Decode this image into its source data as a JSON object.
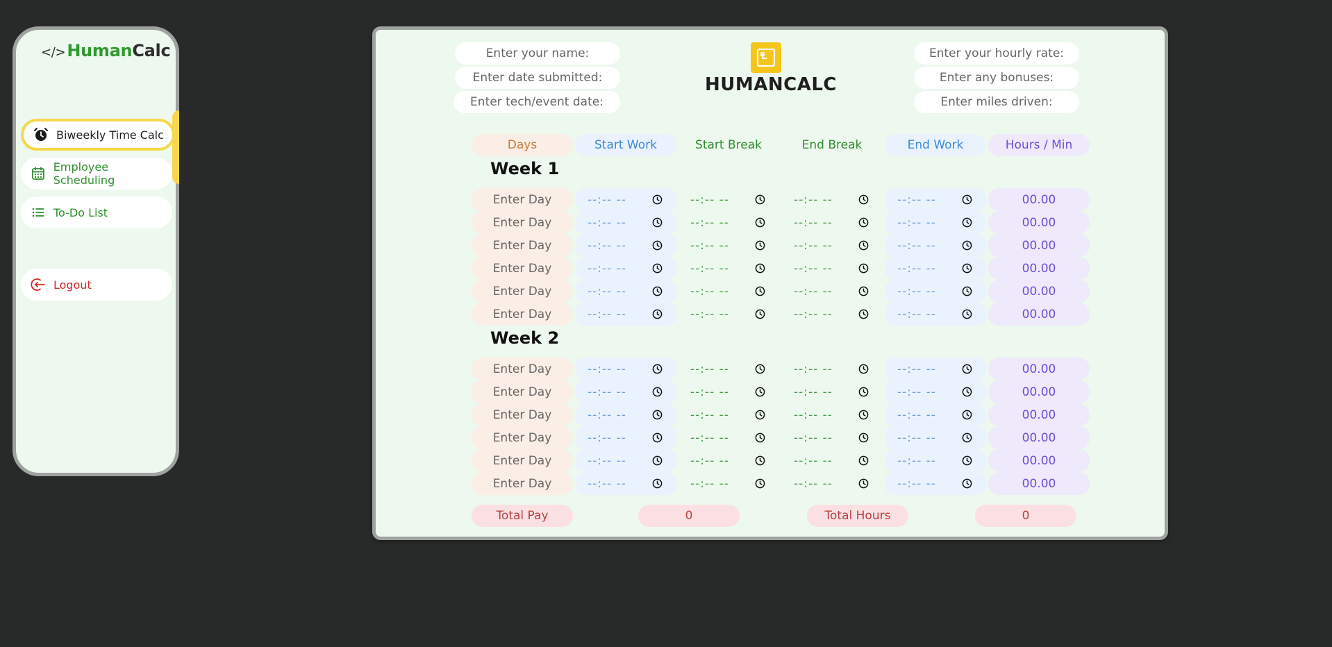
{
  "sidebar": {
    "brand": {
      "code": "</>",
      "human": "Human",
      "calc": "Calc"
    },
    "items": [
      {
        "label": "Biweekly Time Calc",
        "icon": "alarm-clock-icon",
        "active": true
      },
      {
        "label": "Employee Scheduling",
        "icon": "calendar-icon"
      },
      {
        "label": "To-Do List",
        "icon": "list-icon"
      },
      {
        "label": "Logout",
        "icon": "logout-icon"
      }
    ]
  },
  "header": {
    "name_placeholder": "Enter your name:",
    "date_submitted_placeholder": "Enter date submitted:",
    "event_date_placeholder": "Enter tech/event date:",
    "hourly_rate_placeholder": "Enter your hourly rate:",
    "bonuses_placeholder": "Enter any bonuses:",
    "miles_placeholder": "Enter miles driven:",
    "logo_text": "HUMANCALC"
  },
  "columns": {
    "days": "Days",
    "start_work": "Start Work",
    "start_break": "Start Break",
    "end_break": "End Break",
    "end_work": "End Work",
    "hours_min": "Hours / Min"
  },
  "weeks": [
    {
      "title": "Week 1",
      "rows": [
        {
          "day": "Enter Day",
          "start_work": "--:-- --",
          "start_break": "--:-- --",
          "end_break": "--:-- --",
          "end_work": "--:-- --",
          "hours": "00.00"
        },
        {
          "day": "Enter Day",
          "start_work": "--:-- --",
          "start_break": "--:-- --",
          "end_break": "--:-- --",
          "end_work": "--:-- --",
          "hours": "00.00"
        },
        {
          "day": "Enter Day",
          "start_work": "--:-- --",
          "start_break": "--:-- --",
          "end_break": "--:-- --",
          "end_work": "--:-- --",
          "hours": "00.00"
        },
        {
          "day": "Enter Day",
          "start_work": "--:-- --",
          "start_break": "--:-- --",
          "end_break": "--:-- --",
          "end_work": "--:-- --",
          "hours": "00.00"
        },
        {
          "day": "Enter Day",
          "start_work": "--:-- --",
          "start_break": "--:-- --",
          "end_break": "--:-- --",
          "end_work": "--:-- --",
          "hours": "00.00"
        },
        {
          "day": "Enter Day",
          "start_work": "--:-- --",
          "start_break": "--:-- --",
          "end_break": "--:-- --",
          "end_work": "--:-- --",
          "hours": "00.00"
        }
      ]
    },
    {
      "title": "Week 2",
      "rows": [
        {
          "day": "Enter Day",
          "start_work": "--:-- --",
          "start_break": "--:-- --",
          "end_break": "--:-- --",
          "end_work": "--:-- --",
          "hours": "00.00"
        },
        {
          "day": "Enter Day",
          "start_work": "--:-- --",
          "start_break": "--:-- --",
          "end_break": "--:-- --",
          "end_work": "--:-- --",
          "hours": "00.00"
        },
        {
          "day": "Enter Day",
          "start_work": "--:-- --",
          "start_break": "--:-- --",
          "end_break": "--:-- --",
          "end_work": "--:-- --",
          "hours": "00.00"
        },
        {
          "day": "Enter Day",
          "start_work": "--:-- --",
          "start_break": "--:-- --",
          "end_break": "--:-- --",
          "end_work": "--:-- --",
          "hours": "00.00"
        },
        {
          "day": "Enter Day",
          "start_work": "--:-- --",
          "start_break": "--:-- --",
          "end_break": "--:-- --",
          "end_work": "--:-- --",
          "hours": "00.00"
        },
        {
          "day": "Enter Day",
          "start_work": "--:-- --",
          "start_break": "--:-- --",
          "end_break": "--:-- --",
          "end_work": "--:-- --",
          "hours": "00.00"
        }
      ]
    }
  ],
  "totals": {
    "pay_label": "Total Pay",
    "pay_value": "0",
    "hours_label": "Total Hours",
    "hours_value": "0"
  },
  "colors": {
    "background": "#282929",
    "panel": "#edf8ee",
    "accent_yellow": "#f7d84c",
    "brand_green": "#2f9a2f",
    "logout_red": "#cc2a2a"
  }
}
